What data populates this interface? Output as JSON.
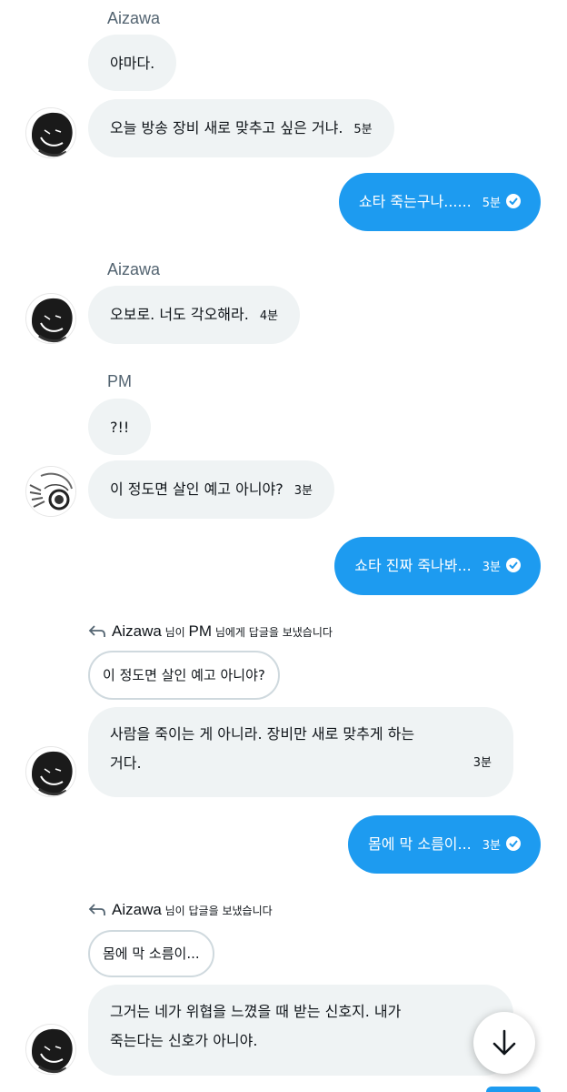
{
  "colors": {
    "incoming_bubble": "#eff3f4",
    "outgoing_bubble": "#1d9bf0",
    "sender_name": "#536471",
    "quote_border": "#cfd9de"
  },
  "messages": [
    {
      "sender": "Aizawa"
    },
    {
      "text": "야마다.",
      "time": ""
    },
    {
      "text": "오늘 방송 장비 새로 맞추고 싶은 거냐.",
      "time": "5분"
    },
    {
      "text": "쇼타 죽는구나......",
      "time": "5분"
    },
    {
      "sender": "Aizawa"
    },
    {
      "text": "오보로. 너도 각오해라.",
      "time": "4분"
    },
    {
      "sender": "PM"
    },
    {
      "text": "?!!",
      "time": ""
    },
    {
      "text": "이 정도면 살인 예고 아니야?",
      "time": "3분"
    },
    {
      "text": "쇼타 진짜 죽나봐...",
      "time": "3분"
    },
    {
      "reply_name": "Aizawa",
      "reply_mid": " 님이 ",
      "reply_target": "PM",
      "reply_suffix": " 님에게 답글을 보냈습니다",
      "quote": "이 정도면 살인 예고 아니야?"
    },
    {
      "text_line1": "사람을 죽이는 게 아니라. 장비만 새로 맞추게 하는",
      "text_line2": "거다.",
      "time": "3분"
    },
    {
      "text": "몸에 막 소름이...",
      "time": "3분"
    },
    {
      "reply_name": "Aizawa",
      "reply_suffix": " 님이 답글을 보냈습니다",
      "quote": "몸에 막 소름이..."
    },
    {
      "text_line1": "그거는 네가 위협을 느꼈을 때 받는 신호지. 내가",
      "text_line2": "죽는다는 신호가 아니야."
    }
  ],
  "icons": {
    "reply": "reply-arrow-icon",
    "read_receipt": "check-circle-icon",
    "scroll_down": "arrow-down-icon"
  }
}
